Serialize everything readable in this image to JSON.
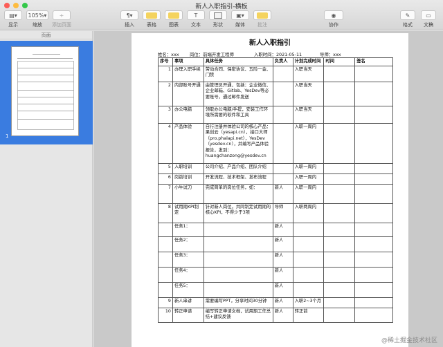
{
  "window": {
    "title": "新人入职指引-横板"
  },
  "toolbar": {
    "view_label": "显示",
    "zoom_value": "105%",
    "zoom_label": "缩放",
    "add_page_label": "添加页面",
    "insert_label": "插入",
    "table_label": "表格",
    "chart_label": "图表",
    "text_label": "文本",
    "shape_label": "形状",
    "media_label": "媒体",
    "comment_label": "批注",
    "collaborate_label": "协作",
    "format_label": "格式",
    "document_label": "文稿"
  },
  "sidebar": {
    "header": "页面",
    "page_number": "1"
  },
  "doc": {
    "title": "新人入职指引",
    "name": "姓名：xxx",
    "position": "岗位：前端开发工程师",
    "date": "入职时间：2021-05-11",
    "mentor": "导师：xxx",
    "headers": [
      "序号",
      "事项",
      "具体任务",
      "负责人",
      "计划完成时间",
      "时间",
      "签名"
    ],
    "rows": [
      {
        "num": "1",
        "item": "办理入职手续",
        "task": "劳动合同、保密协议、五险一金、门禁",
        "owner": "",
        "plan": "入职当天"
      },
      {
        "num": "2",
        "item": "内部账号开通",
        "task": "由管理员开通，包括：企业微信、企业邮箱、Gitlab、YesDev等必要账号，通过邮件发送",
        "owner": "",
        "plan": "入职当天"
      },
      {
        "num": "3",
        "item": "办公电脑",
        "task": "领取办公电脑/手提，安装工作环境所需要的软件和工具",
        "owner": "",
        "plan": "入职当天"
      },
      {
        "num": "4",
        "item": "产品体验",
        "task": "自行注册并体验公司的核心产品：果创云（yesapi.cn），接口大师（pro.phalapi.net），YesDev（yesdev.cn），并编写产品体验报告，发到：huangchanzong@yesdev.cn",
        "owner": "",
        "plan": "入职一周内"
      },
      {
        "num": "5",
        "item": "入职培训",
        "task": "公司介绍、产品介绍、团队介绍",
        "owner": "",
        "plan": "入职一周内"
      },
      {
        "num": "6",
        "item": "岗前培训",
        "task": "开发流程、技术框架、发布流程",
        "owner": "",
        "plan": "入职一周内"
      },
      {
        "num": "7",
        "item": "小牛试刀",
        "task": "完成简单的岗位任务，如：",
        "owner": "新人",
        "plan": "入职一周内"
      },
      {
        "num": "8",
        "item": "试用期KPI制定",
        "task": "针对新人岗位，共同制定试用期的核心KPI，不得少于3项",
        "owner": "导师",
        "plan": "入职两周内"
      },
      {
        "num": "",
        "item": "任务1：",
        "task": "",
        "owner": "新人",
        "plan": ""
      },
      {
        "num": "",
        "item": "任务2：",
        "task": "",
        "owner": "新人",
        "plan": ""
      },
      {
        "num": "",
        "item": "任务3：",
        "task": "",
        "owner": "新人",
        "plan": ""
      },
      {
        "num": "",
        "item": "任务4：",
        "task": "",
        "owner": "新人",
        "plan": ""
      },
      {
        "num": "",
        "item": "任务5：",
        "task": "",
        "owner": "新人",
        "plan": ""
      },
      {
        "num": "9",
        "item": "新人串讲",
        "task": "需要编写PPT，分享时间30分钟",
        "owner": "新人",
        "plan": "入职2~3个月"
      },
      {
        "num": "10",
        "item": "转正申请",
        "task": "编写转正申请文档，试用期工作总结+建议反馈",
        "owner": "新人",
        "plan": "转正前"
      }
    ]
  },
  "watermark": "@稀土掘金技术社区"
}
